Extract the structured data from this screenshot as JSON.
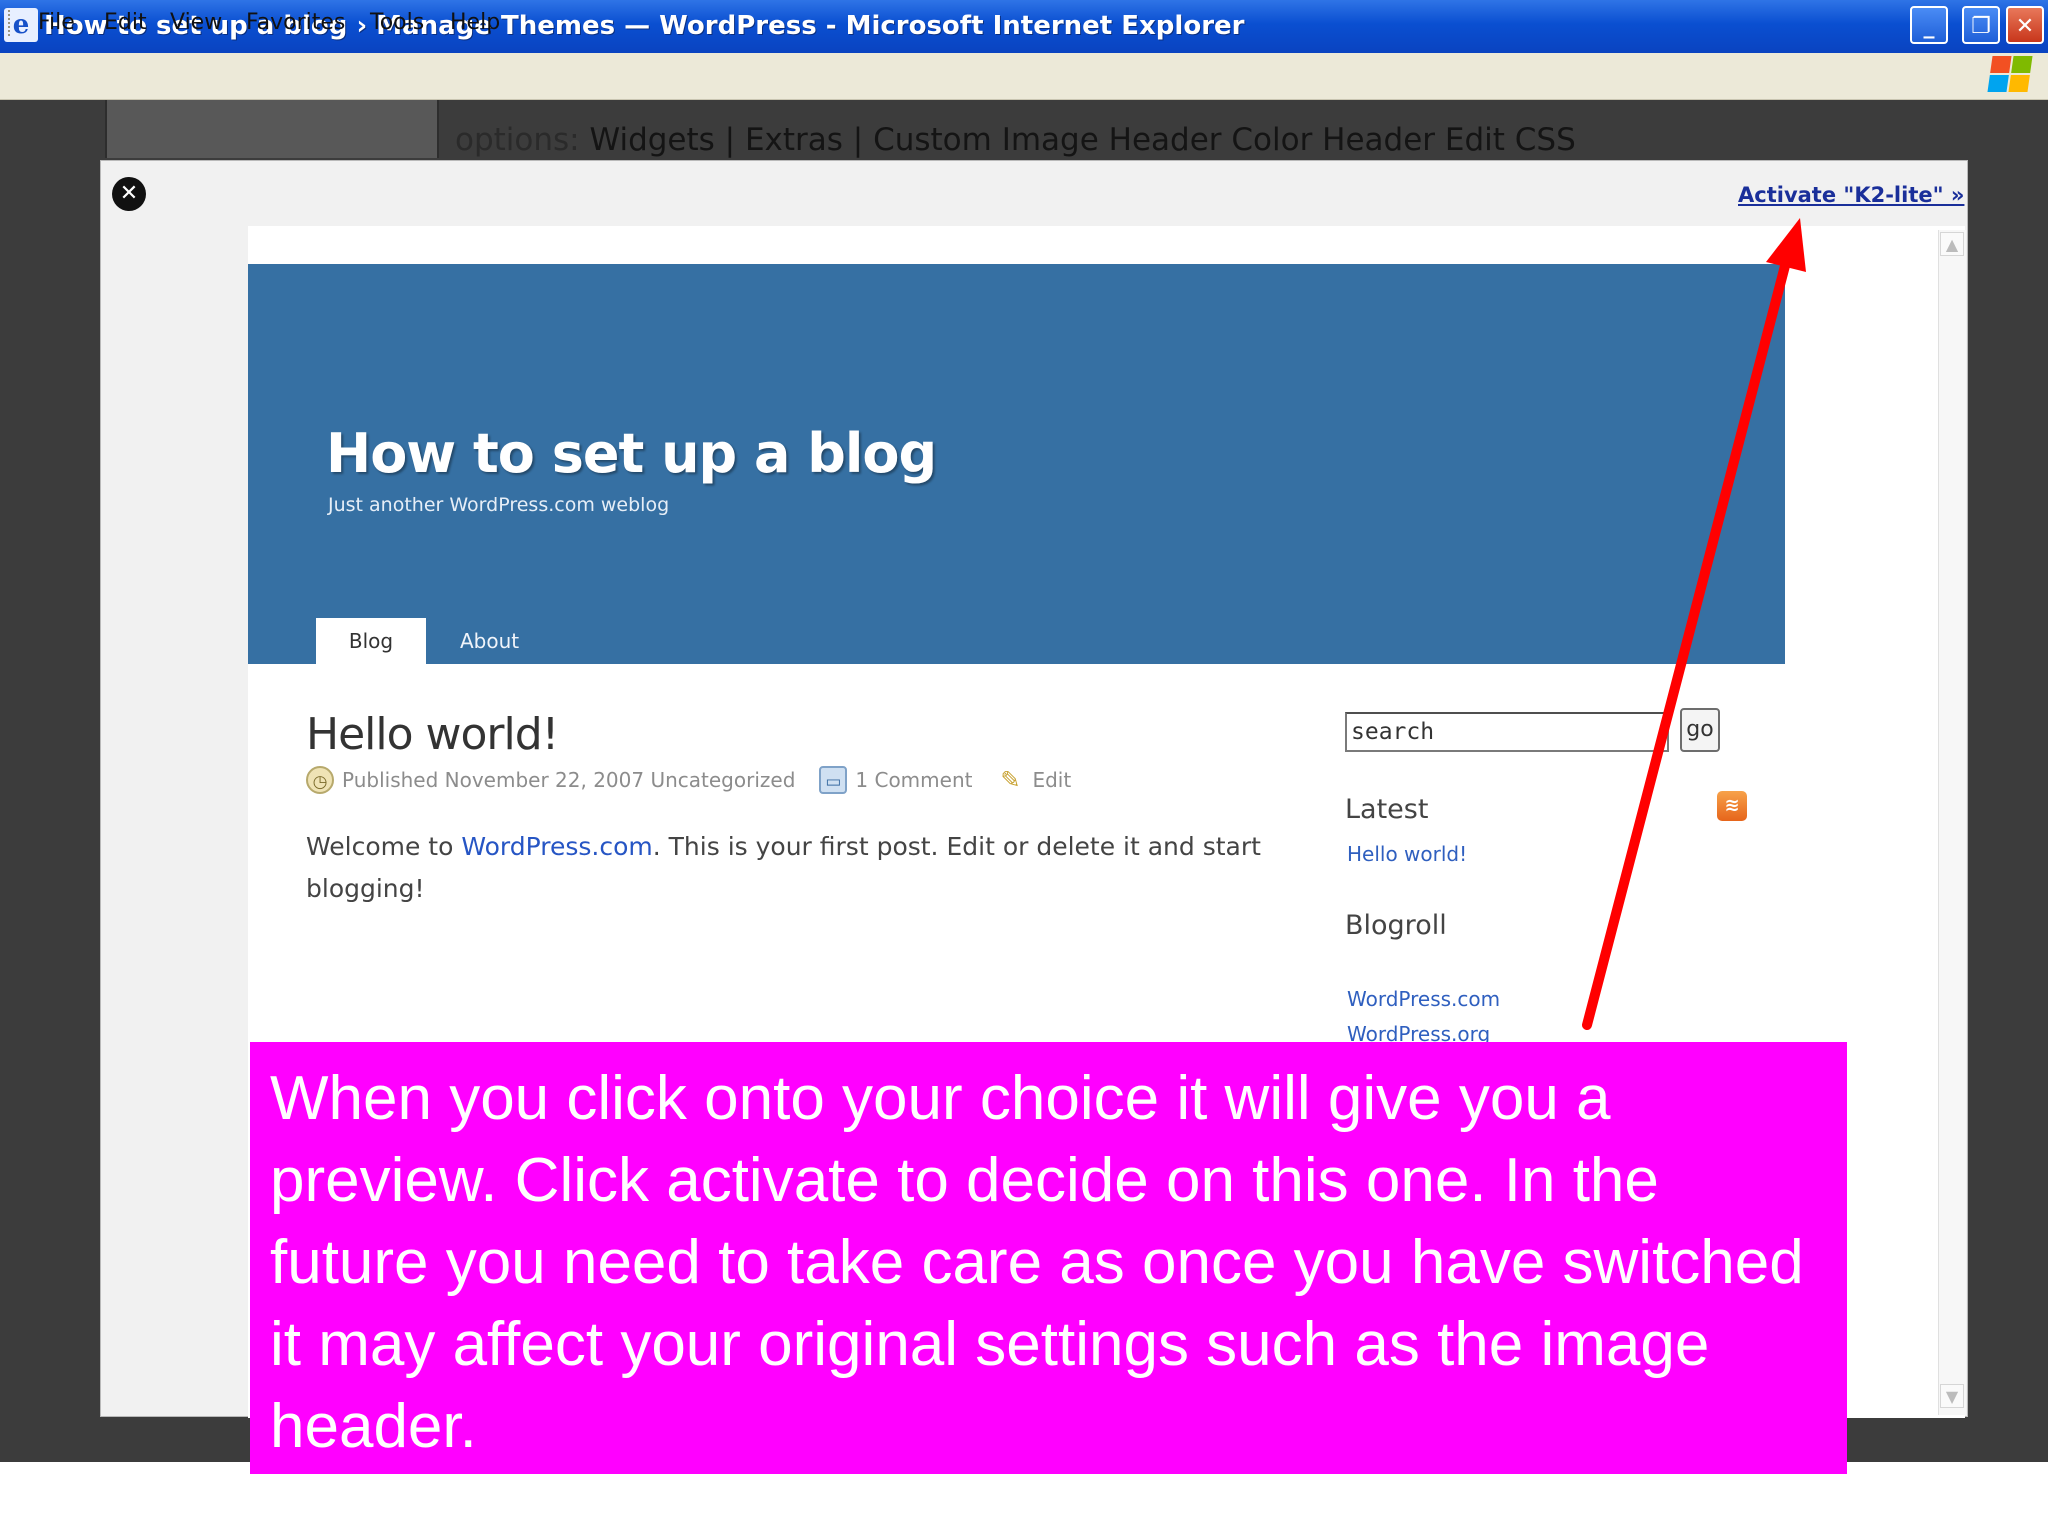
{
  "window": {
    "title": "How to set up a blog › Manage Themes — WordPress - Microsoft Internet Explorer",
    "icon": "ie-icon",
    "controls": {
      "minimize": "_",
      "maximize": "❐",
      "close": "✕"
    }
  },
  "menu": [
    "File",
    "Edit",
    "View",
    "Favorites",
    "Tools",
    "Help"
  ],
  "background_options": {
    "label": "options:",
    "links": "Widgets | Extras | Custom Image Header  Color Header  Edit CSS"
  },
  "modal": {
    "close_symbol": "✕",
    "activate_link": "Activate \"K2-lite\" »"
  },
  "blog": {
    "title": "How to set up a blog",
    "description": "Just another WordPress.com weblog",
    "tabs": [
      "Blog",
      "About"
    ]
  },
  "post": {
    "title": "Hello world!",
    "meta_published": "Published November 22, 2007 Uncategorized",
    "meta_comments": "1 Comment",
    "meta_edit": "Edit",
    "body_before_link": "Welcome to ",
    "body_link": "WordPress.com",
    "body_after_link": ". This is your first post. Edit or delete it and start blogging!"
  },
  "sidebar": {
    "search_value": "search",
    "go_label": "go",
    "latest_heading": "Latest",
    "latest_links": [
      "Hello world!"
    ],
    "blogroll_heading": "Blogroll",
    "blogroll_links": [
      "WordPress.com",
      "WordPress.org"
    ]
  },
  "annotation": {
    "text": "When you click onto your choice it will give you a preview.  Click activate to decide on this one.  In the future you need to take care as once you have switched it may affect your original settings such as the image header.",
    "arrow_color": "#ff0000",
    "box_color": "#ff00ff"
  }
}
